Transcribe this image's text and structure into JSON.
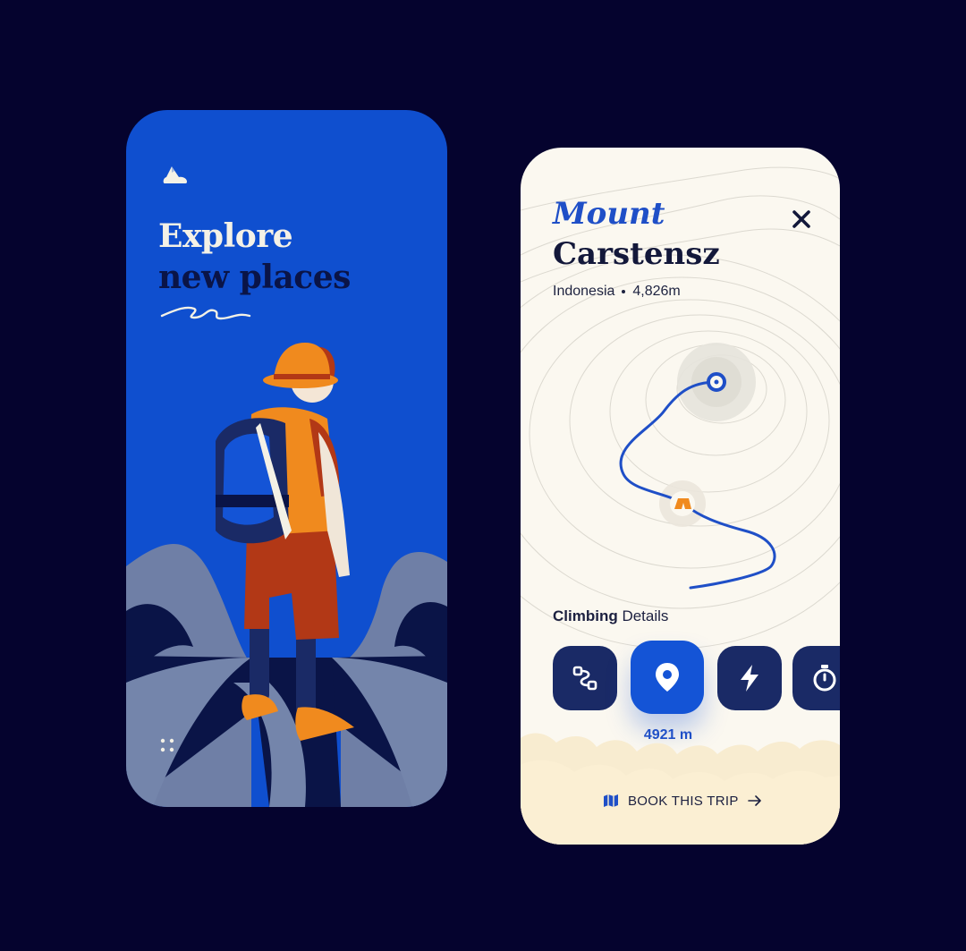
{
  "left_screen": {
    "headline_line1": "Explore",
    "headline_line2": "new places",
    "icons": {
      "logo": "mountain-cloud-logo",
      "menu": "dots-grid-icon"
    }
  },
  "right_screen": {
    "title_line1": "Mount",
    "title_line2": "Carstensz",
    "country": "Indonesia",
    "elevation": "4,826m",
    "section_title_bold": "Climbing",
    "section_title_rest": "Details",
    "detail_tiles": [
      {
        "icon": "route-icon",
        "active": false
      },
      {
        "icon": "location-pin-icon",
        "active": true
      },
      {
        "icon": "lightning-icon",
        "active": false
      },
      {
        "icon": "stopwatch-icon",
        "active": false
      }
    ],
    "active_tile_value": "4921 m",
    "book_button_label": "BOOK THIS TRIP",
    "icons": {
      "close": "close-icon",
      "book": "map-icon",
      "arrow": "arrow-right-icon"
    }
  },
  "colors": {
    "background": "#05032e",
    "primary_blue": "#0f4fcf",
    "navy": "#1a2a66",
    "cream": "#fbf8f0",
    "sand": "#f8ecd0",
    "orange": "#f08a1e"
  }
}
